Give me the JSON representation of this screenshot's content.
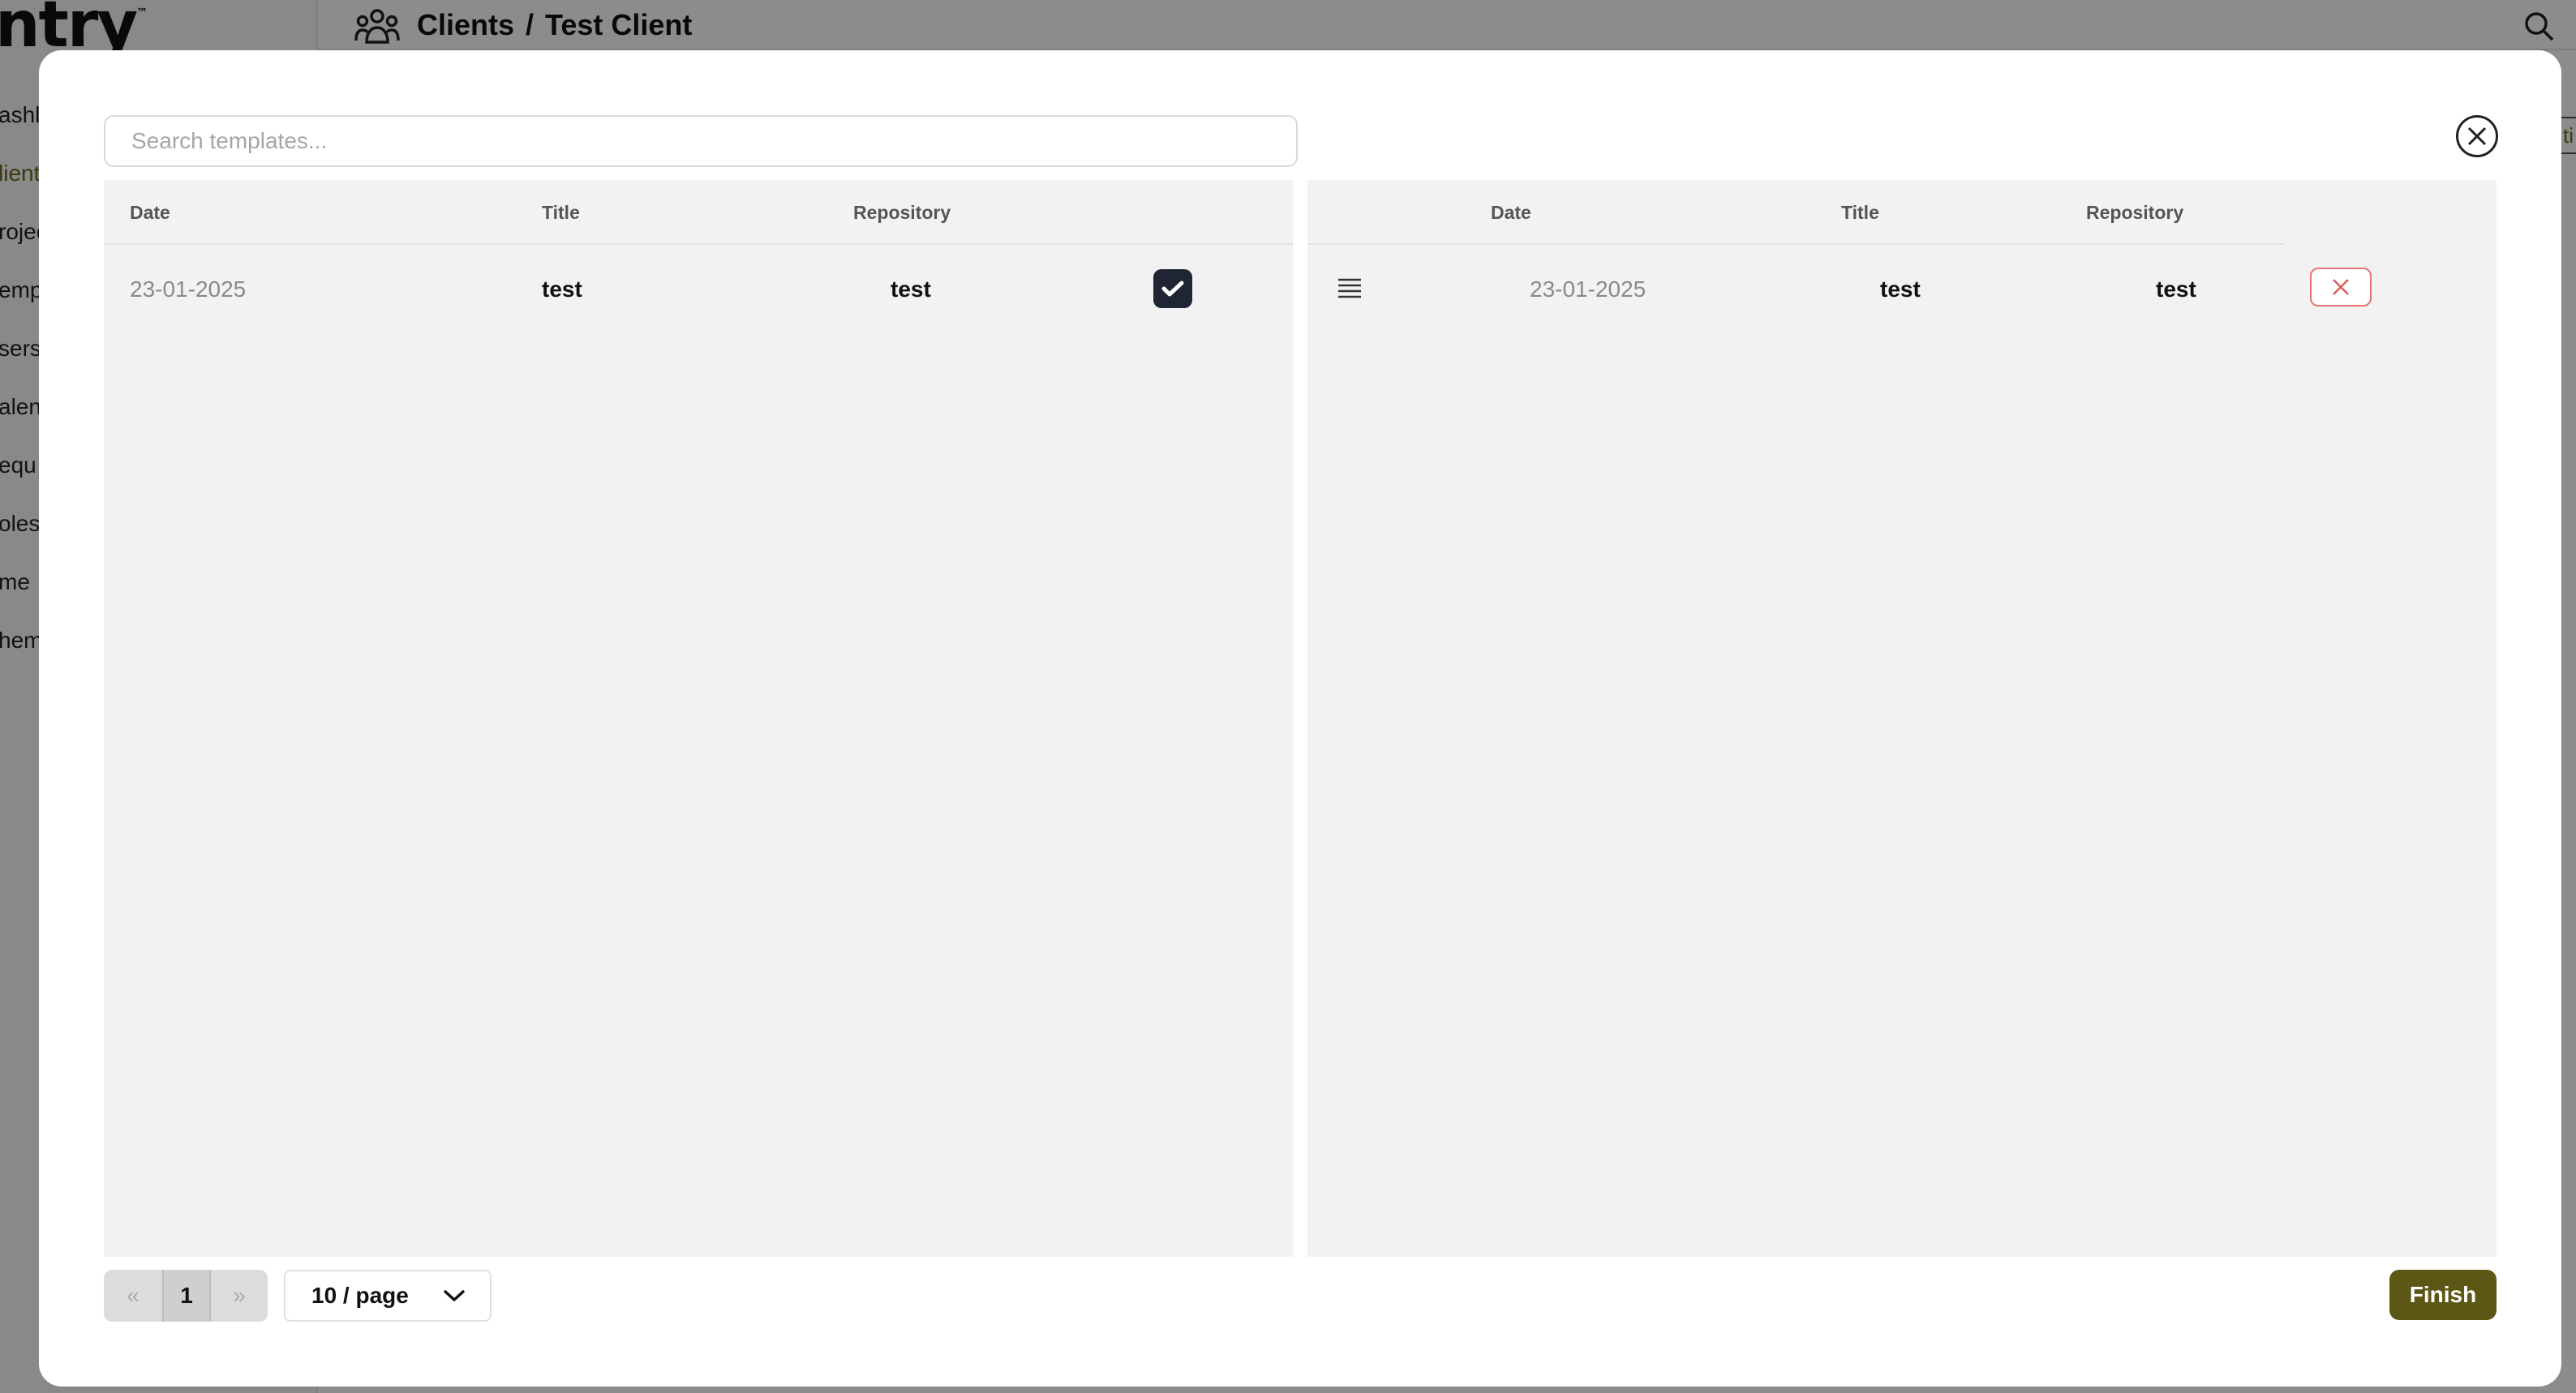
{
  "background": {
    "logo": "ntry",
    "logo_mark": "™",
    "nav_items": [
      "ashl",
      "lient",
      "rojec",
      "emp",
      "sers",
      "alen",
      "equ",
      "oles",
      "me",
      "hem"
    ],
    "breadcrumb": {
      "section": "Clients",
      "separator": "/",
      "page": "Test Client"
    },
    "right_chip": "ti"
  },
  "modal": {
    "search_placeholder": "Search templates...",
    "available": {
      "columns": {
        "date": "Date",
        "title": "Title",
        "repository": "Repository"
      },
      "rows": [
        {
          "date": "23-01-2025",
          "title": "test",
          "repository": "test",
          "selected": true
        }
      ]
    },
    "selected": {
      "columns": {
        "date": "Date",
        "title": "Title",
        "repository": "Repository"
      },
      "rows": [
        {
          "date": "23-01-2025",
          "title": "test",
          "repository": "test"
        }
      ]
    },
    "pagination": {
      "prev": "«",
      "current": "1",
      "next": "»",
      "page_size": "10 / page"
    },
    "finish_label": "Finish"
  },
  "colors": {
    "accent": "#5c5714",
    "checkbox": "#1f2533",
    "remove": "#e57373",
    "panel_bg": "#f2f2f2"
  },
  "icons": [
    "people-icon",
    "search-icon",
    "close-icon",
    "check-icon",
    "drag-handle-icon",
    "remove-x-icon",
    "chevron-down-icon"
  ]
}
